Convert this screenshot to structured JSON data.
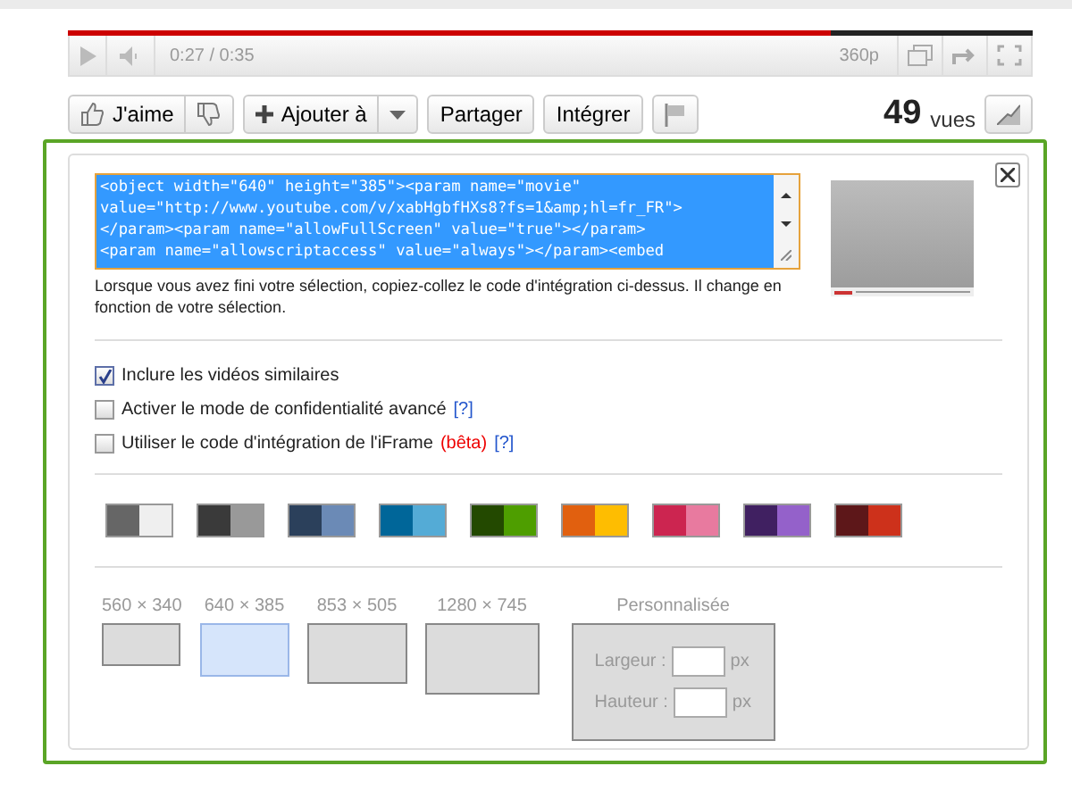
{
  "player": {
    "time": "0:27 / 0:35",
    "quality": "360p",
    "level": 0.79
  },
  "actions": {
    "like": "J'aime",
    "add": "Ajouter à",
    "share": "Partager",
    "embed": "Intégrer",
    "views_count": "49",
    "views_label": "vues"
  },
  "embed_panel": {
    "code_lines": [
      "<object width=\"640\" height=\"385\"><param name=\"movie\"",
      "value=\"http://www.youtube.com/v/xabHgbfHXs8?fs=1&amp;hl=fr_FR\">",
      "</param><param name=\"allowFullScreen\" value=\"true\"></param>",
      "<param name=\"allowscriptaccess\" value=\"always\"></param><embed"
    ],
    "instructions": "Lorsque vous avez fini votre sélection, copiez-collez le code d'intégration ci-dessus. Il change en fonction de votre sélection.",
    "options": [
      {
        "label": "Inclure les vidéos similaires",
        "checked": true
      },
      {
        "label": "Activer le mode de confidentialité avancé",
        "help": "[?]",
        "checked": false
      },
      {
        "label": "Utiliser le code d'intégration de l'iFrame",
        "beta": "(bêta)",
        "help": "[?]",
        "checked": false
      }
    ],
    "color_themes": [
      {
        "halves": [
          {
            "color": "#666666"
          },
          {
            "color": "#efefef"
          }
        ]
      },
      {
        "halves": [
          {
            "color": "#3a3a3a"
          },
          {
            "color": "#999999"
          }
        ]
      },
      {
        "halves": [
          {
            "color": "#2b405b"
          },
          {
            "color": "#6b8ab6"
          }
        ]
      },
      {
        "halves": [
          {
            "color": "#006699"
          },
          {
            "color": "#54abd6"
          }
        ]
      },
      {
        "halves": [
          {
            "color": "#234900"
          },
          {
            "color": "#4e9e00"
          }
        ]
      },
      {
        "halves": [
          {
            "color": "#e1600f"
          },
          {
            "color": "#febd01"
          }
        ]
      },
      {
        "halves": [
          {
            "color": "#cc2550"
          },
          {
            "color": "#e87a9f"
          }
        ]
      },
      {
        "halves": [
          {
            "color": "#402061"
          },
          {
            "color": "#9461ca"
          }
        ]
      },
      {
        "halves": [
          {
            "color": "#5d1719"
          },
          {
            "color": "#cd311b"
          }
        ]
      }
    ],
    "sizes": [
      {
        "label": "560 × 340",
        "selected": false
      },
      {
        "label": "640 × 385",
        "selected": true
      },
      {
        "label": "853 × 505",
        "selected": false
      },
      {
        "label": "1280 × 745",
        "selected": false
      }
    ],
    "custom_size": {
      "title": "Personnalisée",
      "width_label": "Largeur :",
      "height_label": "Hauteur :",
      "width_unit": "px",
      "height_unit": "px"
    }
  }
}
